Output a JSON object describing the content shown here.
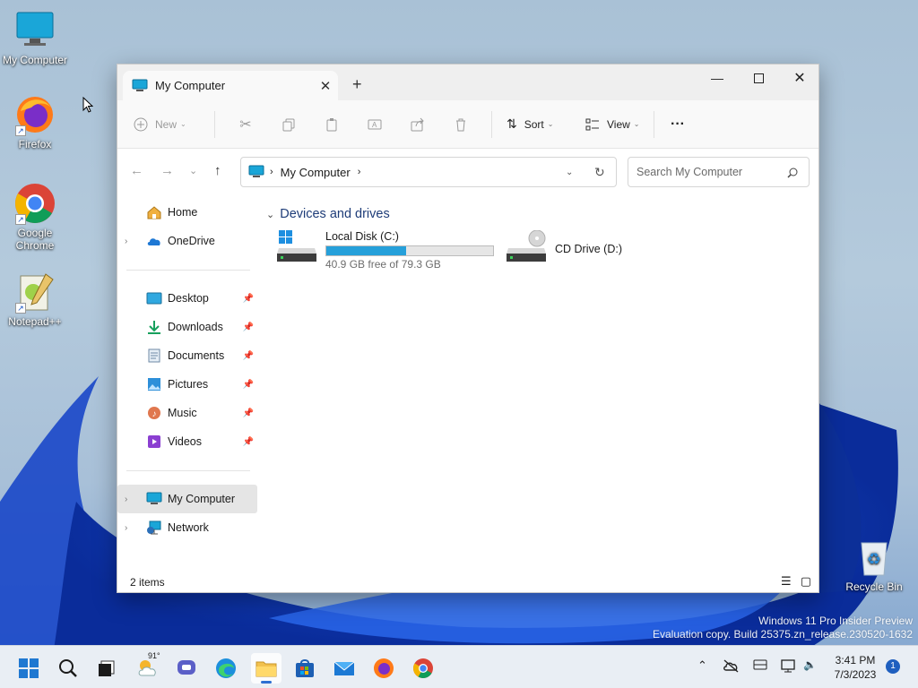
{
  "desktop": {
    "icons": [
      {
        "label": "My Computer"
      },
      {
        "label": "Firefox"
      },
      {
        "label": "Google Chrome"
      },
      {
        "label": "Notepad++"
      },
      {
        "label": "Recycle Bin"
      }
    ],
    "watermark": {
      "line1": "Windows 11 Pro Insider Preview",
      "line2": "Evaluation copy. Build 25375.zn_release.230520-1632"
    }
  },
  "window": {
    "tab_title": "My Computer",
    "toolbar": {
      "new_label": "New",
      "sort_label": "Sort",
      "view_label": "View",
      "more_label": "···"
    },
    "address": {
      "crumb": "My Computer"
    },
    "search": {
      "placeholder": "Search My Computer"
    },
    "sidebar": {
      "items": [
        {
          "label": "Home"
        },
        {
          "label": "OneDrive"
        },
        {
          "label": "Desktop"
        },
        {
          "label": "Downloads"
        },
        {
          "label": "Documents"
        },
        {
          "label": "Pictures"
        },
        {
          "label": "Music"
        },
        {
          "label": "Videos"
        },
        {
          "label": "My Computer"
        },
        {
          "label": "Network"
        }
      ]
    },
    "content": {
      "section_title": "Devices and drives",
      "drives": [
        {
          "name": "Local Disk (C:)",
          "free_text": "40.9 GB free of 79.3 GB",
          "used_fraction": 0.48
        },
        {
          "name": "CD Drive (D:)"
        }
      ]
    },
    "status": {
      "items_text": "2 items"
    }
  },
  "taskbar": {
    "weather_temp": "91°",
    "clock_time": "3:41 PM",
    "clock_date": "7/3/2023",
    "notification_count": "1"
  },
  "colors": {
    "accent": "#26a0da",
    "section_title": "#1e3c78"
  }
}
